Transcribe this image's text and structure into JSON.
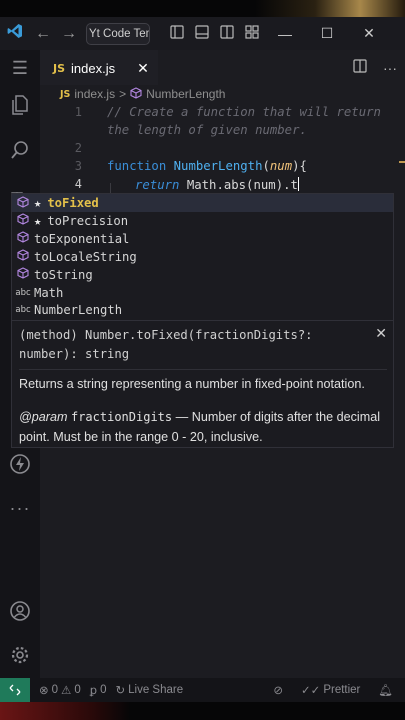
{
  "titlebar": {
    "app_icon": "vscode-logo-icon",
    "back_icon": "arrow-left-icon",
    "forward_icon": "arrow-right-icon",
    "search_text": "Yt Code Temp",
    "layout_icons": [
      "toggle-primary-sidebar-icon",
      "toggle-panel-icon",
      "toggle-secondary-sidebar-icon",
      "customize-layout-icon"
    ],
    "window_controls": [
      "minimize-icon",
      "maximize-icon",
      "close-icon"
    ]
  },
  "activity_bar": {
    "items": [
      "menu-icon",
      "explorer-icon",
      "search-icon",
      "extensions-icon",
      "thunder-client-icon",
      "more-icon",
      "account-icon",
      "settings-gear-icon"
    ]
  },
  "tab": {
    "badge": "JS",
    "label": "index.js",
    "close_glyph": "✕"
  },
  "breadcrumb": {
    "badge": "JS",
    "file": "index.js",
    "separator": ">",
    "symbol": "NumberLength"
  },
  "editor": {
    "line_numbers": [
      "1",
      "2",
      "3",
      "4"
    ],
    "line1_comment": "// Create a function that will return",
    "line1_wrap": "the length of given number.",
    "line3_kw": "function",
    "line3_name": "NumberLength",
    "line3_open": "(",
    "line3_param": "num",
    "line3_close": "){",
    "line4_ret": "return",
    "line4_code": " Math.abs(",
    "line4_arg": "num",
    "line4_tail": ").t"
  },
  "suggestions": [
    {
      "icon": "method-cube-icon",
      "star": "★",
      "label": "toFixed",
      "highlight": true,
      "selected": true
    },
    {
      "icon": "method-cube-icon",
      "star": "★",
      "label": "toPrecision",
      "highlight": false,
      "selected": false
    },
    {
      "icon": "method-cube-icon",
      "star": "",
      "label": "toExponential",
      "highlight": false,
      "selected": false
    },
    {
      "icon": "method-cube-icon",
      "star": "",
      "label": "toLocaleString",
      "highlight": false,
      "selected": false
    },
    {
      "icon": "method-cube-icon",
      "star": "",
      "label": "toString",
      "highlight": false,
      "selected": false
    },
    {
      "icon": "text-abc-icon",
      "star": "",
      "label": "Math",
      "highlight": false,
      "selected": false
    },
    {
      "icon": "text-abc-icon",
      "star": "",
      "label": "NumberLength",
      "highlight": false,
      "selected": false
    }
  ],
  "details": {
    "signature": "(method) Number.toFixed(fractionDigits?: number): string",
    "close_glyph": "✕",
    "description": "Returns a string representing a number in fixed-point notation.",
    "param_tag": "@param",
    "param_name": "fractionDigits",
    "param_desc": " — Number of digits after the decimal point. Must be in the range 0 - 20, inclusive."
  },
  "status_bar": {
    "errors": "0",
    "warnings": "0",
    "ports": "0",
    "live_share": "Live Share",
    "prettier": "Prettier"
  },
  "colors": {
    "accent_blue": "#3a9bd8",
    "js_yellow": "#e3c04a",
    "keyword": "#3a8ed8",
    "param": "#f0c27a",
    "remote_green": "#1f7a5a"
  }
}
